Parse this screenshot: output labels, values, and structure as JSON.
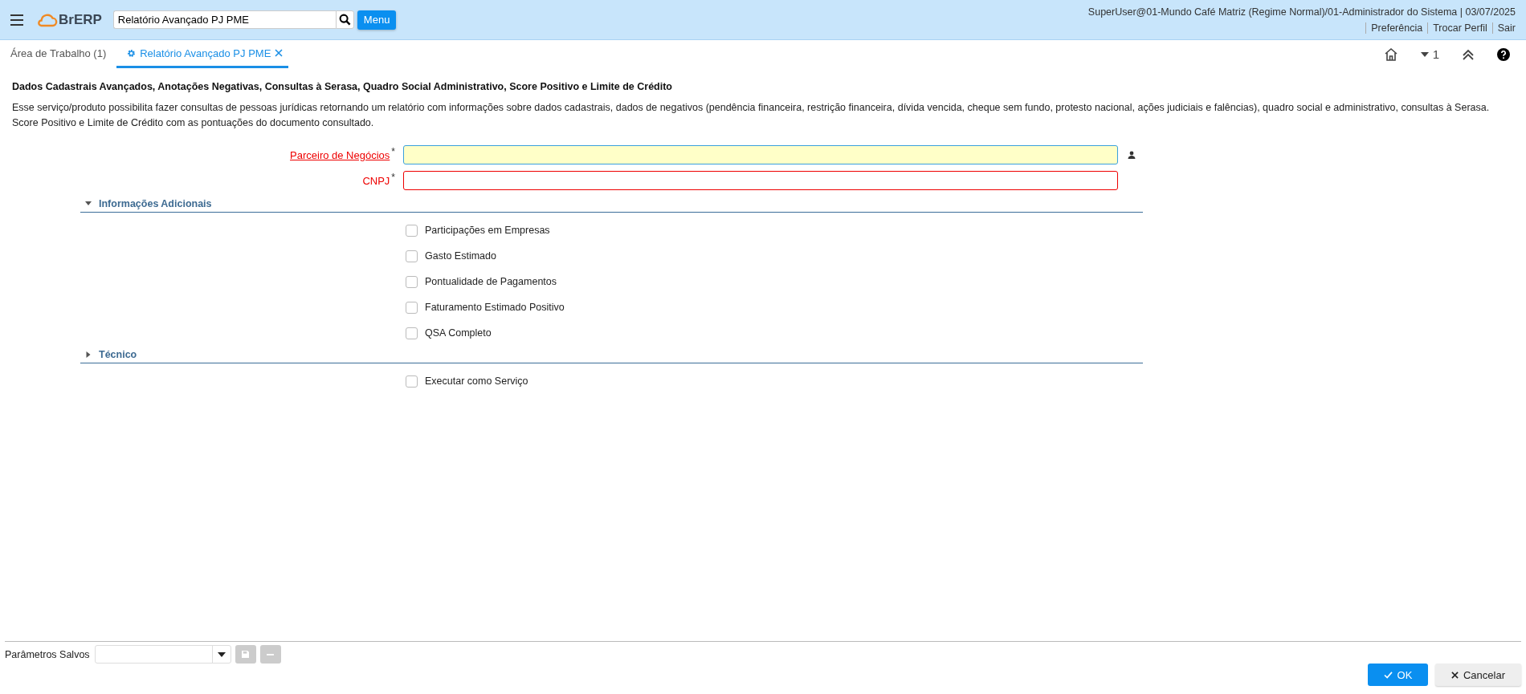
{
  "header": {
    "logo": "BrERP",
    "search": {
      "value": "Relatório Avançado PJ PME"
    },
    "menu_button": "Menu",
    "user_info": "SuperUser@01-Mundo Café Matriz (Regime Normal)/01-Administrador do Sistema | 03/07/2025",
    "links": [
      "Preferência",
      "Trocar Perfil",
      "Sair"
    ]
  },
  "tabs": [
    {
      "label": "Área de Trabalho (1)",
      "selected": false,
      "closable": false
    },
    {
      "label": "Relatório Avançado PJ PME",
      "selected": true,
      "closable": true
    }
  ],
  "toolbar": {
    "window_count": "1"
  },
  "title": "Dados Cadastrais Avançados, Anotações Negativas, Consultas à Serasa, Quadro Social Administrativo, Score Positivo e Limite de Crédito",
  "description": "Esse serviço/produto possibilita fazer consultas de pessoas jurídicas retornando um relatório com informações sobre dados cadastrais, dados de negativos (pendência financeira, restrição financeira, dívida vencida, cheque sem fundo, protesto nacional, ações judiciais e falências), quadro social e administrativo, consultas à Serasa. Score Positivo e Limite de Crédito com as pontuações do documento consultado.",
  "fields": [
    {
      "label": "Parceiro de Negócios",
      "required_marker": "*",
      "kind": "lookup",
      "focused": true
    },
    {
      "label": "CNPJ",
      "required_marker": "*",
      "kind": "text",
      "focused": false
    }
  ],
  "sections": [
    {
      "title": "Informações Adicionais",
      "expanded": true,
      "checkboxes": [
        {
          "label": "Participações em Empresas",
          "checked": false
        },
        {
          "label": "Gasto Estimado",
          "checked": false
        },
        {
          "label": "Pontualidade de Pagamentos",
          "checked": false
        },
        {
          "label": "Faturamento Estimado Positivo",
          "checked": false
        },
        {
          "label": "QSA Completo",
          "checked": false
        }
      ]
    },
    {
      "title": "Técnico",
      "expanded": false,
      "checkboxes": [
        {
          "label": "Executar como Serviço",
          "checked": false
        }
      ]
    }
  ],
  "footer": {
    "saved_params_label": "Parâmetros Salvos",
    "buttons": [
      {
        "label": "OK",
        "kind": "primary"
      },
      {
        "label": "Cancelar",
        "kind": "secondary"
      }
    ]
  }
}
